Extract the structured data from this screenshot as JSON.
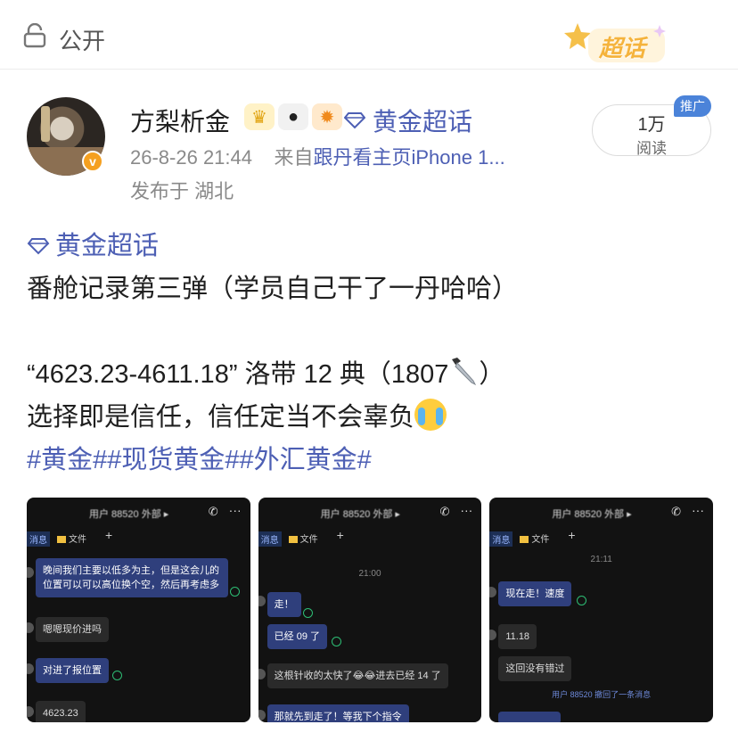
{
  "top_bar": {
    "visibility_icon": "lock-icon",
    "visibility_label": "公开",
    "chaohua_badge": "超话",
    "chaohua_icon": "star-icon"
  },
  "author": {
    "name": "方梨析金",
    "badges": [
      "crown-badge-icon",
      "panda-badge-icon",
      "pufferfish-badge-icon"
    ],
    "topic_link": "黄金超话",
    "topic_icon": "diamond-icon",
    "timestamp": "26-8-26 21:44",
    "source_prefix": "来自",
    "source": "跟丹看主页iPhone 1...",
    "location": "发布于 湖北",
    "verified_icon": "v-verified-icon",
    "read_count": "1万",
    "read_label": "阅读",
    "promo_tag": "推广"
  },
  "post": {
    "topic": "黄金超话",
    "line1": "番舱记录第三弹（学员自己干了一丹哈哈）",
    "line2": "“4623.23-4611.18” 洛带 12 典（1807",
    "line2_emoji": "knife-icon",
    "line2_end": "）",
    "line3": "选择即是信任，信任定当不会辜负",
    "line3_emoji": "crying-face-icon",
    "hashtags": "#黄金##现货黄金##外汇黄金#"
  },
  "screenshots": [
    {
      "title": "用户 88520  外部 ▸",
      "tab_msg": "消息",
      "tab_files": "文件",
      "messages": [
        "晚间我们主要以低多为主，但是这会儿的位置可以可以高位换个空，然后再考虑多",
        "嗯嗯现价进吗",
        "对进了报位置",
        "4623.23"
      ]
    },
    {
      "title": "用户 88520  外部 ▸",
      "tab_msg": "消息",
      "tab_files": "文件",
      "time": "21:00",
      "messages": [
        "走！",
        "已经 09 了",
        "这根针收的太快了😂😂进去已经 14 了",
        "那就先到走了！等我下个指令"
      ]
    },
    {
      "title": "用户 88520  外部 ▸",
      "tab_msg": "消息",
      "tab_files": "文件",
      "time": "21:11",
      "messages": [
        "现在走！速度",
        "11.18",
        "这回没有错过"
      ],
      "recall": "用户 88520 撤回了一条消息"
    }
  ]
}
